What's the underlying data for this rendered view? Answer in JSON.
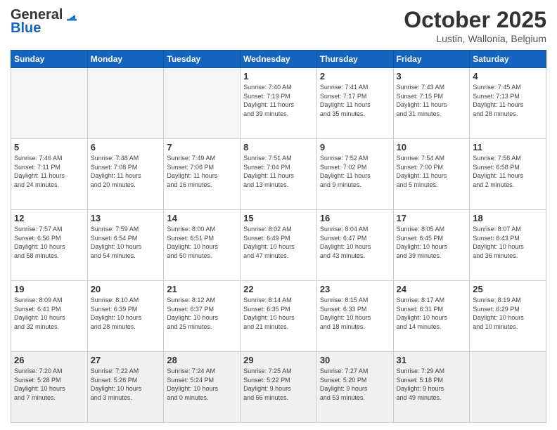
{
  "header": {
    "logo_general": "General",
    "logo_blue": "Blue",
    "month": "October 2025",
    "location": "Lustin, Wallonia, Belgium"
  },
  "days_of_week": [
    "Sunday",
    "Monday",
    "Tuesday",
    "Wednesday",
    "Thursday",
    "Friday",
    "Saturday"
  ],
  "weeks": [
    [
      {
        "day": "",
        "info": ""
      },
      {
        "day": "",
        "info": ""
      },
      {
        "day": "",
        "info": ""
      },
      {
        "day": "1",
        "info": "Sunrise: 7:40 AM\nSunset: 7:19 PM\nDaylight: 11 hours\nand 39 minutes."
      },
      {
        "day": "2",
        "info": "Sunrise: 7:41 AM\nSunset: 7:17 PM\nDaylight: 11 hours\nand 35 minutes."
      },
      {
        "day": "3",
        "info": "Sunrise: 7:43 AM\nSunset: 7:15 PM\nDaylight: 11 hours\nand 31 minutes."
      },
      {
        "day": "4",
        "info": "Sunrise: 7:45 AM\nSunset: 7:13 PM\nDaylight: 11 hours\nand 28 minutes."
      }
    ],
    [
      {
        "day": "5",
        "info": "Sunrise: 7:46 AM\nSunset: 7:11 PM\nDaylight: 11 hours\nand 24 minutes."
      },
      {
        "day": "6",
        "info": "Sunrise: 7:48 AM\nSunset: 7:08 PM\nDaylight: 11 hours\nand 20 minutes."
      },
      {
        "day": "7",
        "info": "Sunrise: 7:49 AM\nSunset: 7:06 PM\nDaylight: 11 hours\nand 16 minutes."
      },
      {
        "day": "8",
        "info": "Sunrise: 7:51 AM\nSunset: 7:04 PM\nDaylight: 11 hours\nand 13 minutes."
      },
      {
        "day": "9",
        "info": "Sunrise: 7:52 AM\nSunset: 7:02 PM\nDaylight: 11 hours\nand 9 minutes."
      },
      {
        "day": "10",
        "info": "Sunrise: 7:54 AM\nSunset: 7:00 PM\nDaylight: 11 hours\nand 5 minutes."
      },
      {
        "day": "11",
        "info": "Sunrise: 7:56 AM\nSunset: 6:58 PM\nDaylight: 11 hours\nand 2 minutes."
      }
    ],
    [
      {
        "day": "12",
        "info": "Sunrise: 7:57 AM\nSunset: 6:56 PM\nDaylight: 10 hours\nand 58 minutes."
      },
      {
        "day": "13",
        "info": "Sunrise: 7:59 AM\nSunset: 6:54 PM\nDaylight: 10 hours\nand 54 minutes."
      },
      {
        "day": "14",
        "info": "Sunrise: 8:00 AM\nSunset: 6:51 PM\nDaylight: 10 hours\nand 50 minutes."
      },
      {
        "day": "15",
        "info": "Sunrise: 8:02 AM\nSunset: 6:49 PM\nDaylight: 10 hours\nand 47 minutes."
      },
      {
        "day": "16",
        "info": "Sunrise: 8:04 AM\nSunset: 6:47 PM\nDaylight: 10 hours\nand 43 minutes."
      },
      {
        "day": "17",
        "info": "Sunrise: 8:05 AM\nSunset: 6:45 PM\nDaylight: 10 hours\nand 39 minutes."
      },
      {
        "day": "18",
        "info": "Sunrise: 8:07 AM\nSunset: 6:43 PM\nDaylight: 10 hours\nand 36 minutes."
      }
    ],
    [
      {
        "day": "19",
        "info": "Sunrise: 8:09 AM\nSunset: 6:41 PM\nDaylight: 10 hours\nand 32 minutes."
      },
      {
        "day": "20",
        "info": "Sunrise: 8:10 AM\nSunset: 6:39 PM\nDaylight: 10 hours\nand 28 minutes."
      },
      {
        "day": "21",
        "info": "Sunrise: 8:12 AM\nSunset: 6:37 PM\nDaylight: 10 hours\nand 25 minutes."
      },
      {
        "day": "22",
        "info": "Sunrise: 8:14 AM\nSunset: 6:35 PM\nDaylight: 10 hours\nand 21 minutes."
      },
      {
        "day": "23",
        "info": "Sunrise: 8:15 AM\nSunset: 6:33 PM\nDaylight: 10 hours\nand 18 minutes."
      },
      {
        "day": "24",
        "info": "Sunrise: 8:17 AM\nSunset: 6:31 PM\nDaylight: 10 hours\nand 14 minutes."
      },
      {
        "day": "25",
        "info": "Sunrise: 8:19 AM\nSunset: 6:29 PM\nDaylight: 10 hours\nand 10 minutes."
      }
    ],
    [
      {
        "day": "26",
        "info": "Sunrise: 7:20 AM\nSunset: 5:28 PM\nDaylight: 10 hours\nand 7 minutes."
      },
      {
        "day": "27",
        "info": "Sunrise: 7:22 AM\nSunset: 5:26 PM\nDaylight: 10 hours\nand 3 minutes."
      },
      {
        "day": "28",
        "info": "Sunrise: 7:24 AM\nSunset: 5:24 PM\nDaylight: 10 hours\nand 0 minutes."
      },
      {
        "day": "29",
        "info": "Sunrise: 7:25 AM\nSunset: 5:22 PM\nDaylight: 9 hours\nand 56 minutes."
      },
      {
        "day": "30",
        "info": "Sunrise: 7:27 AM\nSunset: 5:20 PM\nDaylight: 9 hours\nand 53 minutes."
      },
      {
        "day": "31",
        "info": "Sunrise: 7:29 AM\nSunset: 5:18 PM\nDaylight: 9 hours\nand 49 minutes."
      },
      {
        "day": "",
        "info": ""
      }
    ]
  ]
}
